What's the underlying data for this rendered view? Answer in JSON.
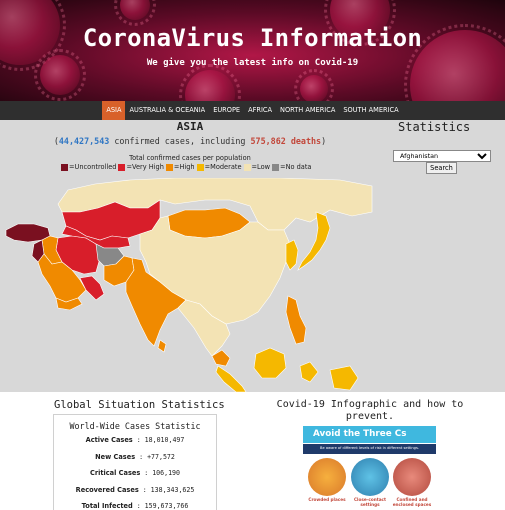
{
  "header": {
    "title": "CoronaVirus Information",
    "subtitle": "We give you the latest info on Covid-19"
  },
  "nav": {
    "items": [
      {
        "label": "ASIA",
        "active": true
      },
      {
        "label": "AUSTRALIA & OCEANIA",
        "active": false
      },
      {
        "label": "EUROPE",
        "active": false
      },
      {
        "label": "AFRICA",
        "active": false
      },
      {
        "label": "NORTH AMERICA",
        "active": false
      },
      {
        "label": "SOUTH AMERICA",
        "active": false
      }
    ]
  },
  "region": {
    "name": "ASIA",
    "summary_open": "(",
    "confirmed_cases": "44,427,543",
    "summary_middle": " confirmed cases, including ",
    "deaths": "575,862 deaths",
    "summary_close": ")"
  },
  "legend": {
    "title": "Total confirmed cases per population",
    "items": [
      {
        "label": "Uncontrolled",
        "color": "#7a1020"
      },
      {
        "label": "Very High",
        "color": "#d81e2a"
      },
      {
        "label": "High",
        "color": "#f08a00"
      },
      {
        "label": "Moderate",
        "color": "#f5b800"
      },
      {
        "label": "Low",
        "color": "#f3e3b4"
      },
      {
        "label": "No data",
        "color": "#888888"
      }
    ]
  },
  "statistics": {
    "title": "Statistics",
    "selected_country": "Afghanistan",
    "search_label": "Search"
  },
  "global": {
    "title": "Global Situation Statistics",
    "subtitle": "World-Wide Cases Statistic",
    "rows": [
      {
        "label": "Active Cases",
        "value": "18,010,497"
      },
      {
        "label": "New Cases",
        "value": "+77,572"
      },
      {
        "label": "Critical Cases",
        "value": "106,190"
      },
      {
        "label": "Recovered Cases",
        "value": "138,343,625"
      },
      {
        "label": "Total Infected",
        "value": "159,673,766"
      }
    ]
  },
  "infographic": {
    "title": "Covid-19 Infographic and how to prevent.",
    "banner": "Avoid the Three Cs",
    "banner_sub": "Be aware of different levels of risk in different settings.",
    "labels": [
      "Crowded places",
      "Close-contact settings",
      "Confined and enclosed spaces"
    ]
  }
}
